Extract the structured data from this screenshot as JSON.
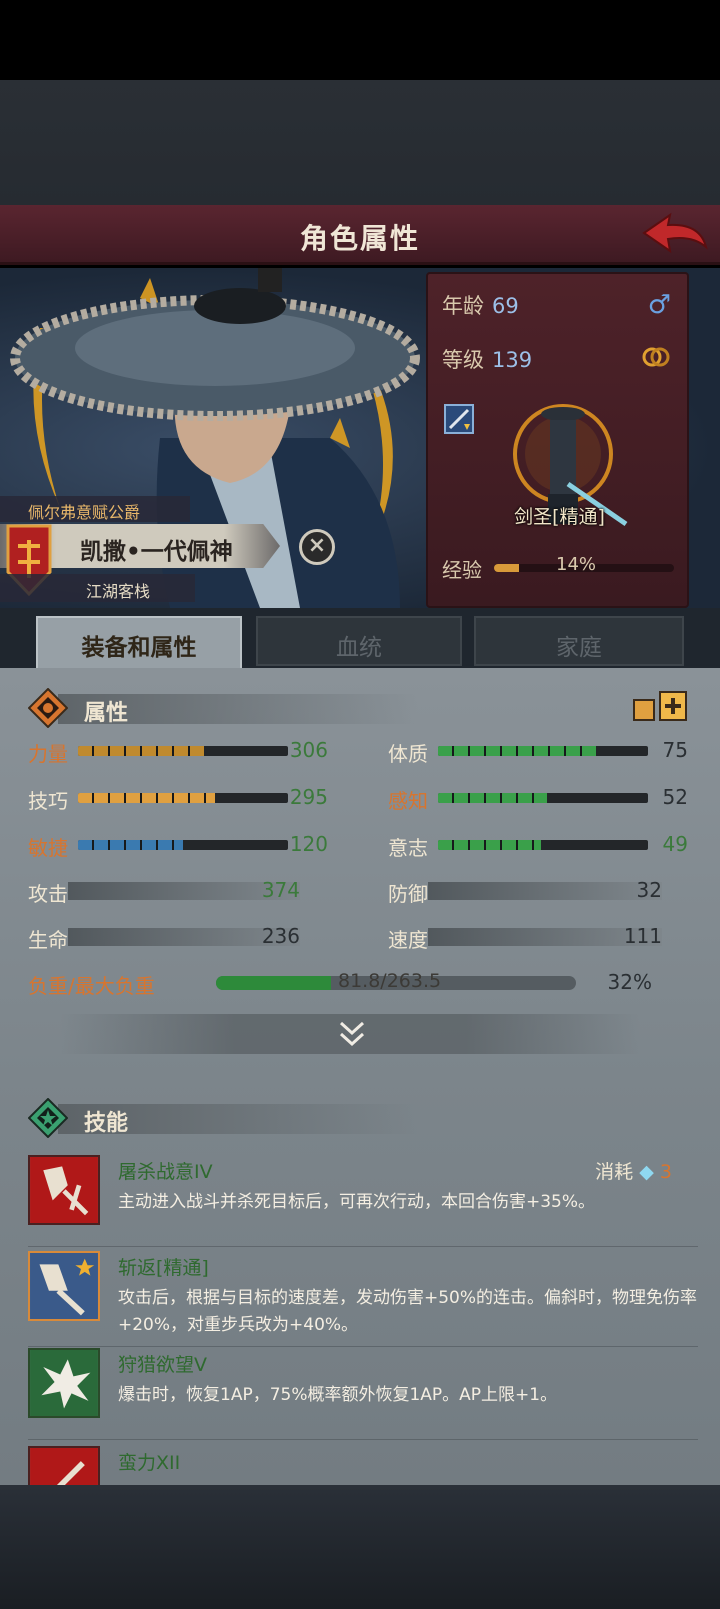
{
  "header": {
    "title": "角色属性"
  },
  "character": {
    "noble_title": "佩尔弗意赋公爵",
    "name": "凯撒•一代佩神",
    "location": "江湖客栈"
  },
  "info": {
    "age_label": "年龄",
    "age": "69",
    "level_label": "等级",
    "level": "139",
    "class_name": "剑圣[精通]",
    "exp_label": "经验",
    "exp_pct": "14%",
    "exp_fraction": 0.14,
    "gender_symbol": "♂"
  },
  "tabs": [
    {
      "label": "装备和属性"
    },
    {
      "label": "血统"
    },
    {
      "label": "家庭"
    }
  ],
  "attributes": {
    "section_label": "属性",
    "stats": [
      {
        "label": "力量",
        "value": "306",
        "fill": 0.6,
        "color": "#c08a2e"
      },
      {
        "label": "体质",
        "value": "75",
        "fill": 0.75,
        "color": "#3aa04a"
      },
      {
        "label": "技巧",
        "value": "295",
        "fill": 0.65,
        "color": "#e0a040"
      },
      {
        "label": "感知",
        "value": "52",
        "fill": 0.52,
        "color": "#3aa04a"
      },
      {
        "label": "敏捷",
        "value": "120",
        "fill": 0.5,
        "color": "#3a7ab0"
      },
      {
        "label": "意志",
        "value": "49",
        "fill": 0.49,
        "color": "#3aa04a"
      }
    ],
    "flat": [
      {
        "label": "攻击",
        "value": "374"
      },
      {
        "label": "防御",
        "value": "32"
      },
      {
        "label": "生命",
        "value": "236"
      },
      {
        "label": "速度",
        "value": "111"
      }
    ],
    "load": {
      "label": "负重/最大负重",
      "text": "81.8/263.5",
      "pct": "32%",
      "fraction": 0.32
    }
  },
  "skills": {
    "section_label": "技能",
    "cost_label": "消耗",
    "cost_value": "3",
    "items": [
      {
        "name": "屠杀战意IV",
        "desc": "主动进入战斗并杀死目标后，可再次行动，本回合伤害+35%。"
      },
      {
        "name": "斩返[精通]",
        "desc": "攻击后，根据与目标的速度差，发动伤害+50%的连击。偏斜时，物理免伤率+20%，对重步兵改为+40%。"
      },
      {
        "name": "狩猎欲望V",
        "desc": "爆击时，恢复1AP，75%概率额外恢复1AP。AP上限+1。"
      },
      {
        "name": "蛮力XII",
        "desc": ""
      }
    ]
  },
  "colors": {
    "title_bar": "#4e2229",
    "accent_orange": "#d7752f",
    "stat_green": "#3b7a3b"
  }
}
